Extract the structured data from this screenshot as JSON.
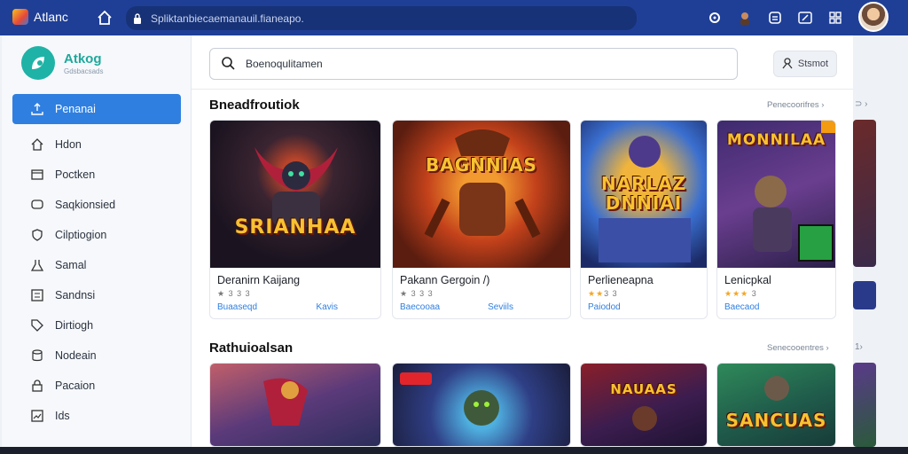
{
  "browser": {
    "app_label": "Atlanc",
    "url": "Spliktanbiecaemanauil.fianeapo.",
    "icons": [
      "settings-gear-icon",
      "character-icon",
      "extensions-icon",
      "edit-icon",
      "grid-icon"
    ]
  },
  "brand": {
    "name": "Atkog",
    "subtitle": "Gdsbacsads"
  },
  "sidebar": {
    "items": [
      {
        "label": "Penanai",
        "icon": "upload-icon",
        "active": true
      },
      {
        "label": "Hdon",
        "icon": "home-icon"
      },
      {
        "label": "Poctken",
        "icon": "folder-icon"
      },
      {
        "label": "Saqkionsied",
        "icon": "chat-icon"
      },
      {
        "label": "Cilptiogion",
        "icon": "shield-icon"
      },
      {
        "label": "Samal",
        "icon": "flask-icon"
      },
      {
        "label": "Sandnsi",
        "icon": "list-icon"
      },
      {
        "label": "Dirtiogh",
        "icon": "tag-icon"
      },
      {
        "label": "Nodeain",
        "icon": "database-icon"
      },
      {
        "label": "Pacaion",
        "icon": "lock-icon"
      },
      {
        "label": "Ids",
        "icon": "image-icon"
      }
    ]
  },
  "search": {
    "value": "Boenoqulitamen",
    "button_label": "Stsmot"
  },
  "sections": [
    {
      "title": "Bneadfroutiok",
      "link": "Penecoorifres",
      "cards": [
        {
          "art_text": "SRIANHAA",
          "name": "Deranirn Kaijang",
          "stars": "★ 3 3 3",
          "left": "Buaaseqd",
          "right": "Kavis"
        },
        {
          "art_text": "BAGNNIAS",
          "name": "Pakann Gergoin /)",
          "stars": "★ 3 3 3",
          "left": "Baecooaa",
          "right": "Seviils"
        },
        {
          "art_text": "NARLAZ DNNIAI",
          "name": "Perlieneapna",
          "stars": "★★3 3",
          "left": "Paiodod",
          "right": ""
        },
        {
          "art_text": "MONNILAA",
          "name": "Lenicpkal",
          "stars": "★★★ 3",
          "left": "Baecaod",
          "right": ""
        }
      ]
    },
    {
      "title": "Rathuioalsan",
      "link": "Senecooentres",
      "cards": [
        {
          "art_text": ""
        },
        {
          "art_text": ""
        },
        {
          "art_text": "NAUAAS"
        },
        {
          "art_text": "SANCUAS"
        }
      ]
    }
  ],
  "colors": {
    "topbar": "#1f3f97",
    "accent": "#2f7fe0",
    "brand": "#1eb3a6",
    "star": "#f5a623"
  }
}
